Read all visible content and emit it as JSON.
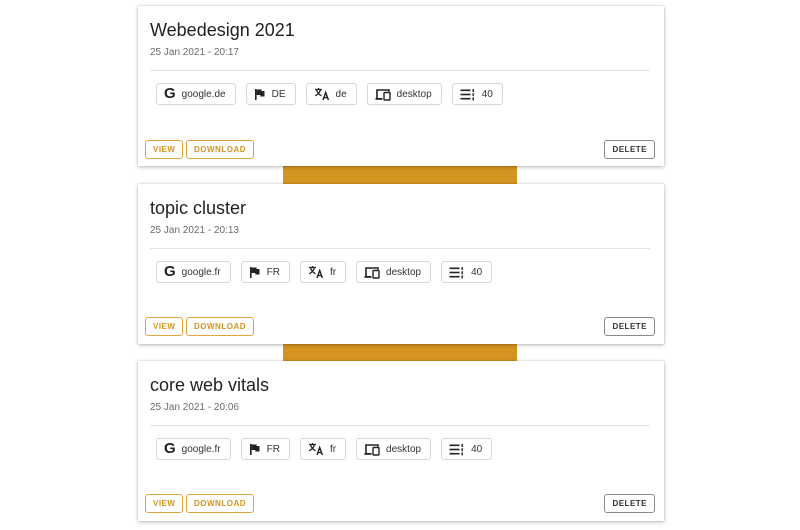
{
  "accent_color": "#d4941f",
  "icons": {
    "engine": "google-icon",
    "country": "flag-icon",
    "language": "translate-icon",
    "device": "devices-icon",
    "results": "list-count-icon"
  },
  "cards": [
    {
      "title": "Webedesign 2021",
      "date": "25 Jan 2021 - 20:17",
      "engine_glyph": "G",
      "engine": "google.de",
      "country": "DE",
      "language": "de",
      "device": "desktop",
      "results": "40",
      "view_label": "VIEW",
      "download_label": "DOWNLOAD",
      "delete_label": "DELETE"
    },
    {
      "title": "topic cluster",
      "date": "25 Jan 2021 - 20:13",
      "engine_glyph": "G",
      "engine": "google.fr",
      "country": "FR",
      "language": "fr",
      "device": "desktop",
      "results": "40",
      "view_label": "VIEW",
      "download_label": "DOWNLOAD",
      "delete_label": "DELETE"
    },
    {
      "title": "core web vitals",
      "date": "25 Jan 2021 - 20:06",
      "engine_glyph": "G",
      "engine": "google.fr",
      "country": "FR",
      "language": "fr",
      "device": "desktop",
      "results": "40",
      "view_label": "VIEW",
      "download_label": "DOWNLOAD",
      "delete_label": "DELETE"
    }
  ]
}
